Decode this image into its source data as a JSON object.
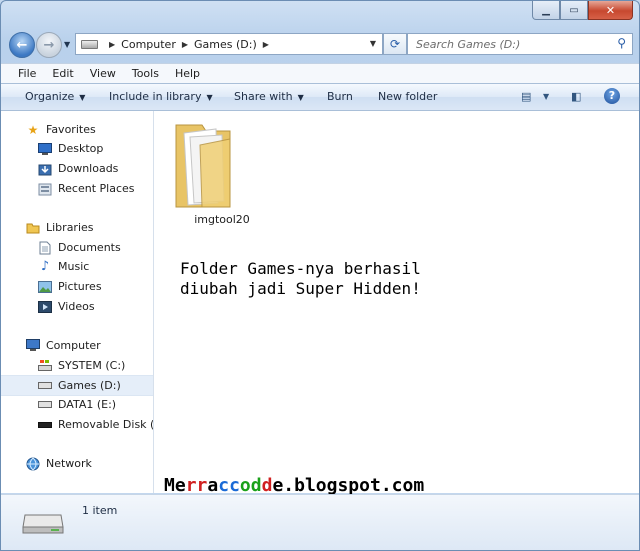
{
  "address_bar": {
    "crumbs": [
      "Computer",
      "Games (D:)"
    ]
  },
  "search": {
    "placeholder": "Search Games (D:)"
  },
  "menu": [
    "File",
    "Edit",
    "View",
    "Tools",
    "Help"
  ],
  "toolbar": {
    "organize": "Organize",
    "include_in_library": "Include in library",
    "share_with": "Share with",
    "burn": "Burn",
    "new_folder": "New folder"
  },
  "sidebar": {
    "favorites": {
      "label": "Favorites",
      "items": [
        "Desktop",
        "Downloads",
        "Recent Places"
      ]
    },
    "libraries": {
      "label": "Libraries",
      "items": [
        "Documents",
        "Music",
        "Pictures",
        "Videos"
      ]
    },
    "computer": {
      "label": "Computer",
      "items": [
        "SYSTEM (C:)",
        "Games (D:)",
        "DATA1 (E:)",
        "Removable Disk (L:)"
      ],
      "selected": "Games (D:)"
    },
    "network": {
      "label": "Network"
    }
  },
  "content": {
    "items": [
      {
        "name": "imgtool20",
        "type": "folder"
      }
    ],
    "overlay_text_line1": "Folder Games-nya berhasil",
    "overlay_text_line2": "diubah jadi Super Hidden!",
    "watermark": {
      "parts": [
        "Me",
        "r",
        "r",
        "a",
        "c",
        "c",
        "o",
        "d",
        "d",
        "e",
        ".blogspot.com"
      ],
      "colors": [
        "#000000",
        "#d02020",
        "#d02020",
        "#000000",
        "#1a6ad6",
        "#1a6ad6",
        "#1aa01a",
        "#1aa01a",
        "#d02020",
        "#000000",
        "#000000"
      ]
    }
  },
  "details_pane": {
    "count_label": "1 item"
  },
  "colors": {
    "accent": "#3c78c3",
    "selection": "#e5eef9",
    "close_button": "#c7482f"
  }
}
